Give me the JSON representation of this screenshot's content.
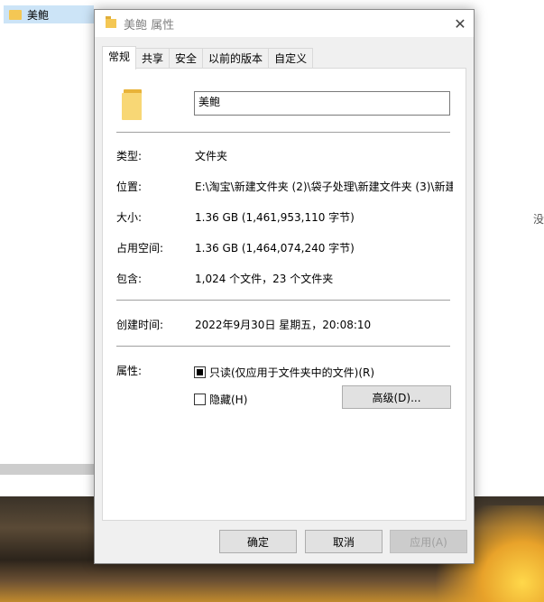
{
  "background": {
    "explorer_item": "美鲍",
    "side_text": "没"
  },
  "dialog": {
    "title": "美鲍 属性",
    "close_glyph": "✕",
    "tabs": [
      {
        "label": "常规",
        "active": true
      },
      {
        "label": "共享",
        "active": false
      },
      {
        "label": "安全",
        "active": false
      },
      {
        "label": "以前的版本",
        "active": false
      },
      {
        "label": "自定义",
        "active": false
      }
    ],
    "general": {
      "name_value": "美鲍",
      "type_label": "类型:",
      "type_value": "文件夹",
      "location_label": "位置:",
      "location_value": "E:\\淘宝\\新建文件夹 (2)\\袋子处理\\新建文件夹 (3)\\新建",
      "size_label": "大小:",
      "size_value": "1.36 GB (1,461,953,110 字节)",
      "size_on_disk_label": "占用空间:",
      "size_on_disk_value": "1.36 GB (1,464,074,240 字节)",
      "contains_label": "包含:",
      "contains_value": "1,024 个文件，23 个文件夹",
      "created_label": "创建时间:",
      "created_value": "2022年9月30日 星期五，20:08:10",
      "attributes_label": "属性:",
      "readonly_label": "只读(仅应用于文件夹中的文件)(R)",
      "readonly_state": "indeterminate",
      "hidden_label": "隐藏(H)",
      "hidden_state": "unchecked",
      "advanced_label": "高级(D)..."
    },
    "footer": {
      "ok_label": "确定",
      "cancel_label": "取消",
      "apply_label": "应用(A)"
    }
  },
  "icons": {
    "folder": "folder-icon",
    "close": "close-icon"
  },
  "colors": {
    "folder_yellow": "#f8d775",
    "selection": "#cce4f7",
    "disabled_text": "#a0a0a0"
  }
}
